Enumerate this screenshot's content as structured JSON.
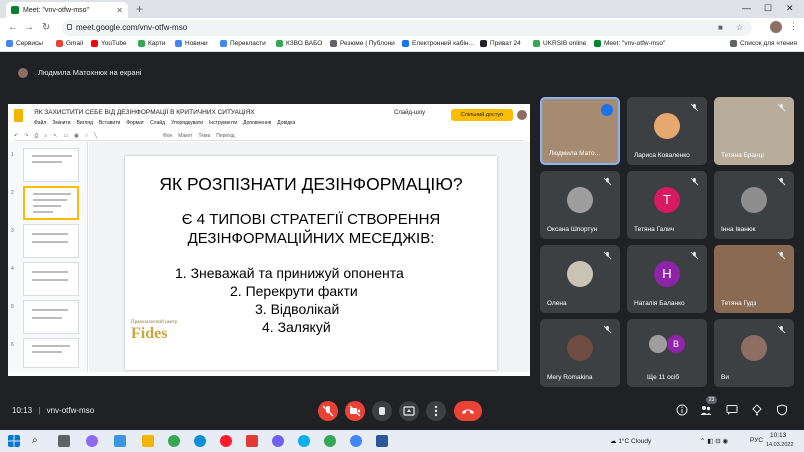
{
  "browser": {
    "tab_title": "Meet: \"vnv-otfw-mso\"",
    "url": "meet.google.com/vnv-otfw-mso",
    "bookmarks": [
      "Сервисы",
      "Gmail",
      "YouTube",
      "Карти",
      "Новини",
      "Переклaсти",
      "КЗВО ВАБО",
      "Резюме | Публони",
      "Електронний кабін...",
      "Приват 24",
      "UKRSIB online",
      "Meet: \"vnv-otfw-mso\"",
      "Список для чтения"
    ]
  },
  "meet": {
    "presenter_label": "Людмила Матохнюк на екрані",
    "meeting_code": "vnv-otfw-mso",
    "time": "10:13",
    "participants_count": "23",
    "participants": [
      {
        "name": "Людмила Мато...",
        "type": "video",
        "speaking": true
      },
      {
        "name": "Лариса Коваленко",
        "type": "photo",
        "color": "#e6a86e"
      },
      {
        "name": "Тетяна Бранці",
        "type": "video"
      },
      {
        "name": "Оксана Шпортун",
        "type": "photo",
        "color": "#9e9e9e"
      },
      {
        "name": "Тетяна Галич",
        "type": "letter",
        "letter": "T",
        "color": "#d81b60"
      },
      {
        "name": "Інна Іванюк",
        "type": "photo",
        "color": "#8d8d8d"
      },
      {
        "name": "Олена",
        "type": "photo",
        "color": "#c9c4b5"
      },
      {
        "name": "Наталія Баланко",
        "type": "letter",
        "letter": "Н",
        "color": "#8e24aa"
      },
      {
        "name": "Тетяна Гудз",
        "type": "video"
      },
      {
        "name": "Mery Romakina",
        "type": "photo",
        "color": "#6d4c41"
      },
      {
        "name": "Ще 11 осіб",
        "type": "more"
      },
      {
        "name": "Ви",
        "type": "photo",
        "color": "#8d6e63"
      }
    ]
  },
  "slides": {
    "doc_title": "ЯК ЗАХИСТИТИ СЕБЕ ВІД ДЕЗІНФОРМАЦІЇ В КРИТИЧНИХ СИТУАЦІЯХ",
    "menu": [
      "Файл",
      "Змінити",
      "Вигляд",
      "Вставити",
      "Формат",
      "Слайд",
      "Упорядкувати",
      "Інструменти",
      "Доповнення",
      "Довідка"
    ],
    "toolbar": [
      "Фон",
      "Макет",
      "Тема",
      "Перехід"
    ],
    "slideshow_label": "Слайд-шоу",
    "share_label": "Спільний доступ",
    "slide": {
      "title": "ЯК РОЗПІЗНАТИ ДЕЗІНФОРМАЦІЮ?",
      "subtitle_line1": "Є 4 ТИПОВІ СТРАТЕГІЇ СТВОРЕННЯ",
      "subtitle_line2": "ДЕЗІНФОРМАЦІЙНИХ МЕСЕДЖІВ:",
      "items": [
        "1.  Зневажай та принижуй опонента",
        "2.  Перекрути факти",
        "3.  Відволікай",
        "4.  Залякуй"
      ],
      "logo_small": "Правозахисний центр",
      "logo_big": "Fides"
    }
  },
  "taskbar": {
    "weather": "1°C  Cloudy",
    "lang": "РУС",
    "clock_time": "10:13",
    "clock_date": "14.03.2022"
  }
}
